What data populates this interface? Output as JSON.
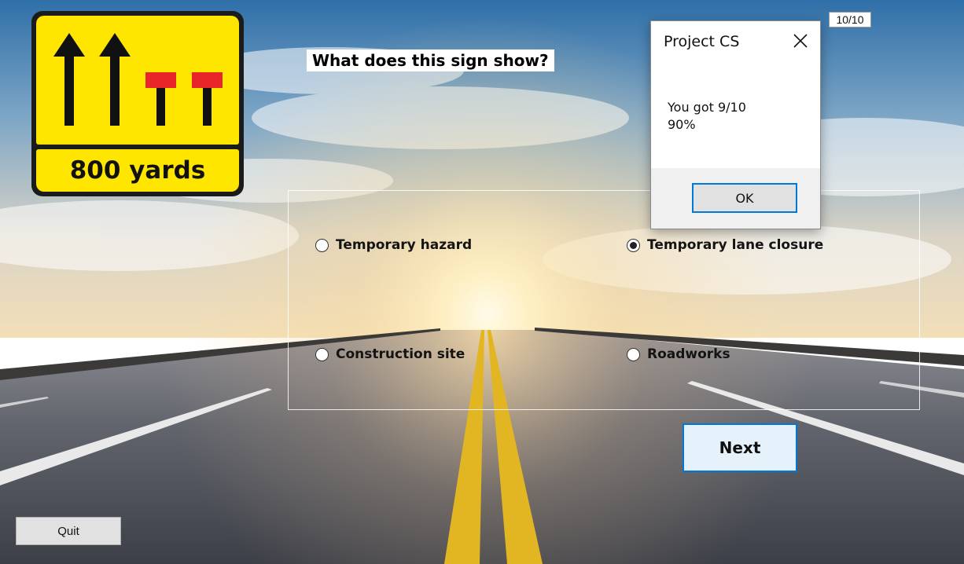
{
  "question": {
    "text": "What does this sign show?"
  },
  "counter": {
    "text": "10/10"
  },
  "sign": {
    "distance": "800 yards"
  },
  "options": [
    {
      "label": "Temporary hazard",
      "checked": false
    },
    {
      "label": "Temporary lane closure",
      "checked": true
    },
    {
      "label": "Construction site",
      "checked": false
    },
    {
      "label": "Roadworks",
      "checked": false
    }
  ],
  "buttons": {
    "next": "Next",
    "quit": "Quit"
  },
  "dialog": {
    "title": "Project CS",
    "message_line1": "You got 9/10",
    "message_line2": "90%",
    "ok": "OK"
  },
  "colors": {
    "sign_yellow": "#ffe600",
    "sign_red": "#e8262a",
    "accent_blue": "#0078d7",
    "road_line_yellow": "#e2b523"
  }
}
